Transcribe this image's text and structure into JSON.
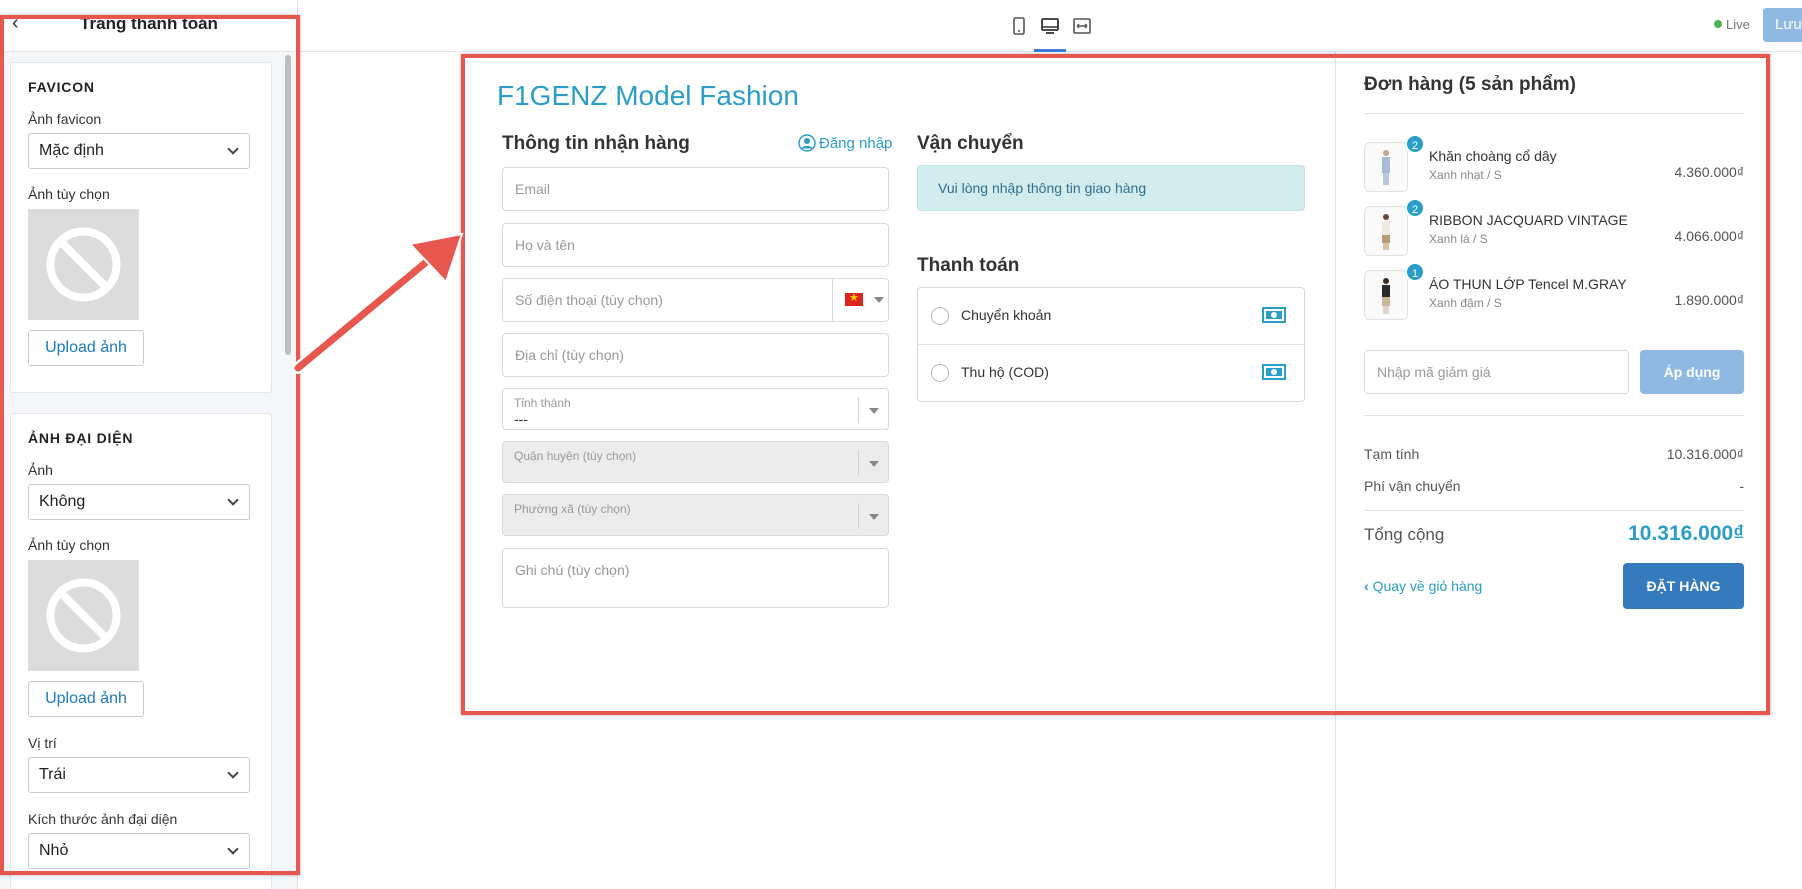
{
  "left_panel": {
    "title": "Trang thanh toán",
    "favicon": {
      "heading": "FAVICON",
      "favicon_label": "Ảnh favicon",
      "favicon_value": "Mặc định",
      "custom_label": "Ảnh tùy chọn",
      "upload_label": "Upload ảnh"
    },
    "avatar": {
      "heading": "ẢNH ĐẠI DIỆN",
      "image_label": "Ảnh",
      "image_value": "Không",
      "custom_label": "Ảnh tùy chọn",
      "upload_label": "Upload ảnh",
      "position_label": "Vị trí",
      "position_value": "Trái",
      "size_label": "Kích thước ảnh đại diện",
      "size_value": "Nhỏ"
    }
  },
  "topbar": {
    "devices": [
      "mobile-icon",
      "desktop-icon",
      "fullwidth-icon"
    ],
    "active_device": "desktop",
    "live_label": "Live",
    "save_label": "Lưu"
  },
  "checkout": {
    "shop_name": "F1GENZ Model Fashion",
    "shipping_info": {
      "title": "Thông tin nhận hàng",
      "login_label": "Đăng nhập",
      "email_placeholder": "Email",
      "name_placeholder": "Họ và tên",
      "phone_placeholder": "Số điện thoại (tùy chọn)",
      "address_placeholder": "Địa chỉ (tùy chọn)",
      "province_label": "Tỉnh thành",
      "province_value": "---",
      "district_label": "Quận huyện (tùy chọn)",
      "ward_label": "Phường xã (tùy chọn)",
      "note_placeholder": "Ghi chú (tùy chọn)"
    },
    "shipping": {
      "title": "Vận chuyển",
      "notice": "Vui lòng nhập thông tin giao hàng"
    },
    "payment": {
      "title": "Thanh toán",
      "methods": [
        "Chuyển khoản",
        "Thu hộ (COD)"
      ]
    },
    "order": {
      "title": "Đơn hàng (5 sản phẩm)",
      "items": [
        {
          "qty": "2",
          "name": "Khăn choàng cổ dây",
          "variant": "Xanh nhạt / S",
          "price": "4.360.000₫"
        },
        {
          "qty": "2",
          "name": "RIBBON JACQUARD VINTAGE",
          "variant": "Xanh lá / S",
          "price": "4.066.000₫"
        },
        {
          "qty": "1",
          "name": "ÁO THUN LỚP Tencel M.GRAY",
          "variant": "Xanh đậm / S",
          "price": "1.890.000₫"
        }
      ],
      "coupon_placeholder": "Nhập mã giảm giá",
      "apply_label": "Áp dụng",
      "subtotal_label": "Tạm tính",
      "subtotal_value": "10.316.000₫",
      "shipping_fee_label": "Phí vận chuyển",
      "shipping_fee_value": "-",
      "total_label": "Tổng cộng",
      "total_value": "10.316.000₫",
      "back_label": "Quay về giỏ hàng",
      "place_order_label": "ĐẶT HÀNG"
    }
  },
  "colors": {
    "accent": "#2a9dc8",
    "primary_button": "#357abd",
    "annotation": "#e8574d"
  }
}
